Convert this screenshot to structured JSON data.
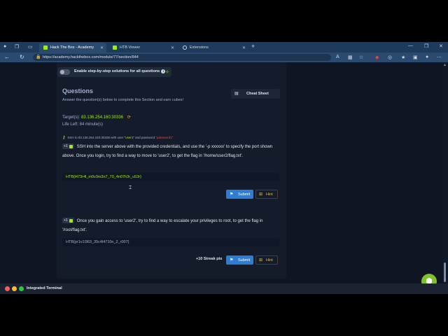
{
  "tabs": [
    {
      "label": "Hack The Box - Academy",
      "active": true
    },
    {
      "label": "HTB Viewer",
      "active": false
    },
    {
      "label": "Extensions",
      "active": false
    }
  ],
  "address": {
    "url": "https://academy.hackthebox.com/module/77/section/844"
  },
  "solutions_toggle": {
    "label": "Enable step-by-step solutions for all questions"
  },
  "questions": {
    "title": "Questions",
    "subtitle": "Answer the question(s) below to complete this Section and earn cubes!",
    "cheat_sheet_label": "Cheat Sheet",
    "targets_label": "Target(s):",
    "target_ip": "83.136.254.160:30336",
    "life_left": "Life Left: 84 minute(s)",
    "ssh_note": {
      "prefix": "SSH to 83.136.254.160:30336 with user ",
      "user": "\"user1\"",
      "middle": " and password ",
      "password": "\"password1\""
    },
    "items": [
      {
        "badge": "+1",
        "text": "SSH into the server above with the provided credentials, and use the '-p xxxxxx' to specify the port shown above. Once you login, try to find a way to move to 'user2', to get the flag in '/home/user2/flag.txt'.",
        "answer": "HTB{l473r4l_m0v3m3n7_70_4n07h3r_u53r}"
      },
      {
        "badge": "+1",
        "text": "Once you gain access to 'user2', try to find a way to escalate your privileges to root, to get the flag in '/root/flag.txt'.",
        "answer": "HTB{pr1v1l363_35c4l4710n_2_r007}"
      }
    ],
    "submit_label": "Submit",
    "hint_label": "Hint",
    "streak": "+10 Streak pts"
  },
  "terminal": {
    "label": "Integrated Terminal"
  },
  "colors": {
    "accent": "#9fef00",
    "submit": "#2d7dd2",
    "hint": "#e8b949",
    "tabbar": "#1e3a5c"
  }
}
